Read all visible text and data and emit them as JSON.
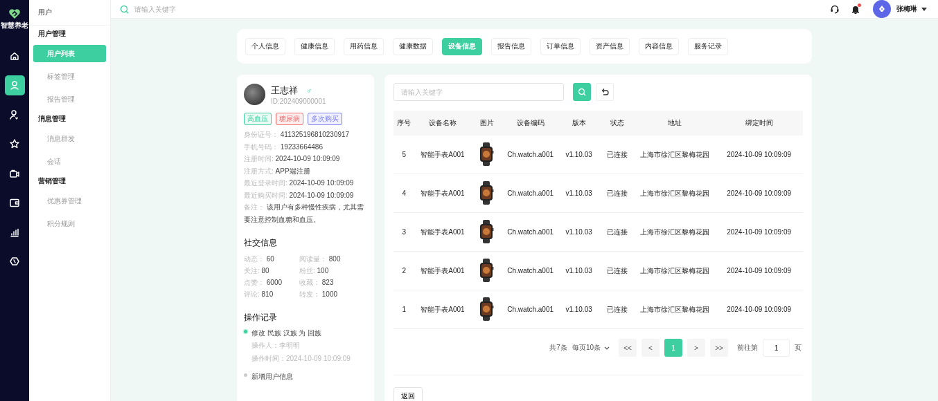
{
  "brand": {
    "name": "智慧养老"
  },
  "rail": [
    {
      "kind": "home",
      "selected": false
    },
    {
      "kind": "user",
      "selected": true
    },
    {
      "kind": "user-heart",
      "selected": false
    },
    {
      "kind": "star",
      "selected": false
    },
    {
      "kind": "video",
      "selected": false
    },
    {
      "kind": "wallet",
      "selected": false
    },
    {
      "kind": "chart",
      "selected": false
    },
    {
      "kind": "hexagon",
      "selected": false
    }
  ],
  "submenu": {
    "title": "用户",
    "groups": [
      {
        "label": "用户管理",
        "items": [
          {
            "label": "用户列表",
            "selected": true
          },
          {
            "label": "标签管理",
            "selected": false
          },
          {
            "label": "报告管理",
            "selected": false
          }
        ]
      },
      {
        "label": "消息管理",
        "items": [
          {
            "label": "消息群发",
            "selected": false
          },
          {
            "label": "会话",
            "selected": false
          }
        ]
      },
      {
        "label": "营销管理",
        "items": [
          {
            "label": "优惠券管理",
            "selected": false
          },
          {
            "label": "积分规则",
            "selected": false
          }
        ]
      }
    ]
  },
  "topbar": {
    "search": {
      "placeholder": "请输入关键字"
    },
    "has_unread": true,
    "user_name": "张梅琳"
  },
  "tabs": [
    {
      "label": "个人信息",
      "selected": false
    },
    {
      "label": "健康信息",
      "selected": false
    },
    {
      "label": "用药信息",
      "selected": false
    },
    {
      "label": "健康数据",
      "selected": false
    },
    {
      "label": "设备信息",
      "selected": true
    },
    {
      "label": "报告信息",
      "selected": false
    },
    {
      "label": "订单信息",
      "selected": false
    },
    {
      "label": "资产信息",
      "selected": false
    },
    {
      "label": "内容信息",
      "selected": false
    },
    {
      "label": "服务记录",
      "selected": false
    }
  ],
  "profile": {
    "name": "王志祥",
    "gender": "♂",
    "id": "ID:202409000001",
    "tags": [
      {
        "label": "高血压",
        "color": "#3ecf9c"
      },
      {
        "label": "糖尿病",
        "color": "#f06a6a"
      },
      {
        "label": "多次购买",
        "color": "#7a7ef0"
      }
    ],
    "fields": [
      {
        "label": "身份证号：",
        "value": "411325196810230917"
      },
      {
        "label": "手机号码：",
        "value": "19233664486"
      },
      {
        "label": "注册时间:",
        "value": "2024-10-09 10:09:09"
      },
      {
        "label": "注册方式:",
        "value": "APP端注册"
      },
      {
        "label": "最近登录时间:",
        "value": "2024-10-09 10:09:09"
      },
      {
        "label": "最近购买时间:",
        "value": "2024-10-09 10:09:09"
      },
      {
        "label": "备注：",
        "value": "该用户有多种慢性疾病，尤其需要注意控制血糖和血压。"
      }
    ],
    "social": {
      "title": "社交信息",
      "stats": [
        {
          "label": "动态：",
          "value": "60"
        },
        {
          "label": "阅读量：",
          "value": "800"
        },
        {
          "label": "关注:",
          "value": "80"
        },
        {
          "label": "粉丝:",
          "value": "100"
        },
        {
          "label": "点赞：",
          "value": "6000"
        },
        {
          "label": "收藏：",
          "value": "823"
        },
        {
          "label": "评论:",
          "value": "810"
        },
        {
          "label": "转发：",
          "value": "1000"
        }
      ]
    },
    "log": {
      "title": "操作记录",
      "entries": [
        {
          "title": "修改 民族 汉族 为 回族",
          "active": true,
          "operator": "操作人：李明明",
          "time": "操作时间：2024-10-09 10:09:09"
        },
        {
          "title": "新增用户信息",
          "active": false
        }
      ]
    }
  },
  "devices": {
    "search": {
      "placeholder": "请输入关键字"
    },
    "columns": [
      "序号",
      "设备名称",
      "图片",
      "设备编码",
      "版本",
      "状态",
      "地址",
      "绑定时间"
    ],
    "rows": [
      [
        "5",
        "智能手表A001",
        "",
        "Ch.watch.a001",
        "v1.10.03",
        "已连接",
        "上海市徐汇区黎梅花园",
        "2024-10-09 10:09:09"
      ],
      [
        "4",
        "智能手表A001",
        "",
        "Ch.watch.a001",
        "v1.10.03",
        "已连接",
        "上海市徐汇区黎梅花园",
        "2024-10-09 10:09:09"
      ],
      [
        "3",
        "智能手表A001",
        "",
        "Ch.watch.a001",
        "v1.10.03",
        "已连接",
        "上海市徐汇区黎梅花园",
        "2024-10-09 10:09:09"
      ],
      [
        "2",
        "智能手表A001",
        "",
        "Ch.watch.a001",
        "v1.10.03",
        "已连接",
        "上海市徐汇区黎梅花园",
        "2024-10-09 10:09:09"
      ],
      [
        "1",
        "智能手表A001",
        "",
        "Ch.watch.a001",
        "v1.10.03",
        "已连接",
        "上海市徐汇区黎梅花园",
        "2024-10-09 10:09:09"
      ]
    ],
    "pager": {
      "total": "共7条",
      "page_size": "每页10条",
      "first": "<<",
      "prev": "<",
      "pages": [
        {
          "label": "1",
          "selected": true
        }
      ],
      "next": ">",
      "last": ">>",
      "goto_label": "前往第",
      "goto_value": "1",
      "goto_suffix": "页"
    },
    "back": "返回"
  }
}
